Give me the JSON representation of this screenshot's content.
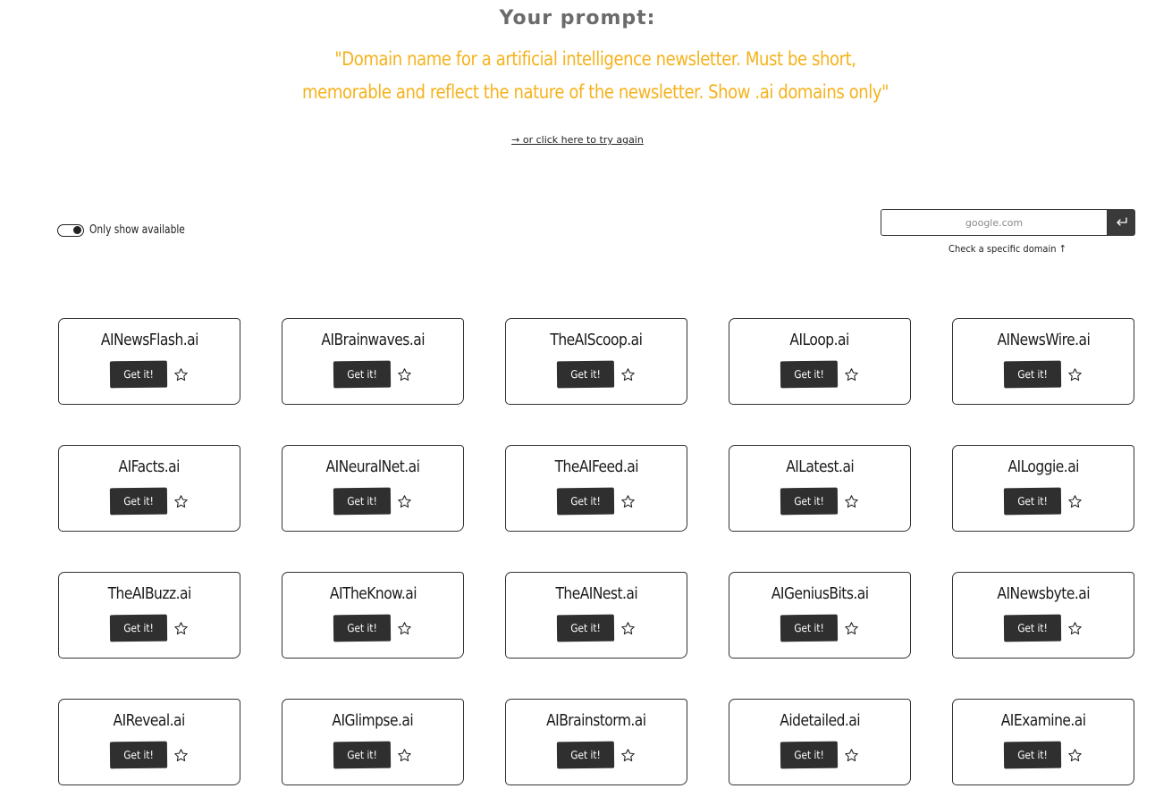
{
  "header": {
    "heading": "Your prompt:",
    "prompt": "\"Domain name for a artificial intelligence newsletter. Must be short, memorable and reflect the nature of the newsletter. Show .ai domains only\"",
    "retry_link": "→ or click here to try again"
  },
  "filters": {
    "only_available_label": "Only show available",
    "only_available_on": true
  },
  "search": {
    "placeholder": "google.com",
    "hint": "Check a specific domain ↑",
    "submit_icon": "enter-icon"
  },
  "colors": {
    "prompt": "#f5b21c",
    "heading": "#6b6b6b",
    "button": "#2f2f2f"
  },
  "card_button_label": "Get it!",
  "domains": [
    {
      "name": "AINewsFlash.ai"
    },
    {
      "name": "AIBrainwaves.ai"
    },
    {
      "name": "TheAIScoop.ai"
    },
    {
      "name": "AILoop.ai"
    },
    {
      "name": "AINewsWire.ai"
    },
    {
      "name": "AIFacts.ai"
    },
    {
      "name": "AINeuralNet.ai"
    },
    {
      "name": "TheAIFeed.ai"
    },
    {
      "name": "AILatest.ai"
    },
    {
      "name": "AILoggie.ai"
    },
    {
      "name": "TheAIBuzz.ai"
    },
    {
      "name": "AITheKnow.ai"
    },
    {
      "name": "TheAINest.ai"
    },
    {
      "name": "AIGeniusBits.ai"
    },
    {
      "name": "AINewsbyte.ai"
    },
    {
      "name": "AIReveal.ai"
    },
    {
      "name": "AIGlimpse.ai"
    },
    {
      "name": "AIBrainstorm.ai"
    },
    {
      "name": "Aidetailed.ai"
    },
    {
      "name": "AIExamine.ai"
    }
  ]
}
